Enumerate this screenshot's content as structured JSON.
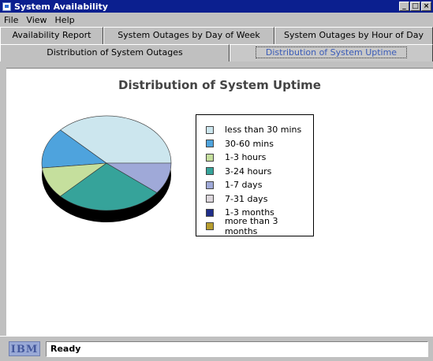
{
  "window": {
    "title": "System Availability"
  },
  "menu": {
    "items": [
      "File",
      "View",
      "Help"
    ]
  },
  "tabs": {
    "row1": [
      "Availability Report",
      "System Outages by Day of Week",
      "System Outages by Hour of Day"
    ],
    "row2": [
      "Distribution of System Outages",
      "Distribution of System Uptime"
    ],
    "active": "Distribution of System Uptime"
  },
  "chart_data": {
    "type": "pie",
    "title": "Distribution of System Uptime",
    "categories": [
      "less than 30 mins",
      "30-60 mins",
      "1-3 hours",
      "3-24 hours",
      "1-7 days",
      "7-31 days",
      "1-3 months",
      "more than 3 months"
    ],
    "values": [
      35,
      13,
      10,
      25,
      10,
      0,
      0,
      0
    ],
    "colors": [
      "#cce6ee",
      "#4ea3dd",
      "#c5df9d",
      "#36a39a",
      "#9fa9d8",
      "#dcd6dc",
      "#1f2e8a",
      "#b79d2e"
    ],
    "legend_position": "right"
  },
  "status": {
    "logo_text": "IBM",
    "text": "Ready"
  },
  "icons": {
    "app": "app-icon",
    "minimize": "minimize-icon",
    "maximize": "maximize-icon",
    "close": "close-icon"
  }
}
